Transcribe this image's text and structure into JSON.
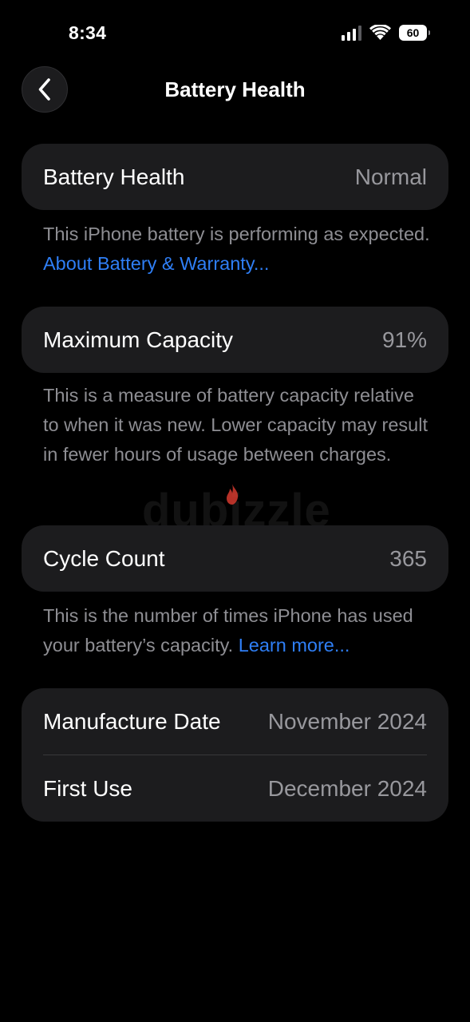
{
  "status_bar": {
    "time": "8:34",
    "battery_level": "60",
    "signal_bars_active": 3,
    "signal_bars_total": 4
  },
  "nav": {
    "title": "Battery Health",
    "back_icon": "chevron-left-icon"
  },
  "battery_health": {
    "label": "Battery Health",
    "value": "Normal",
    "note": "This iPhone battery is performing as expected.",
    "link": "About Battery & Warranty..."
  },
  "maximum_capacity": {
    "label": "Maximum Capacity",
    "value": "91%",
    "note": "This is a measure of battery capacity relative to when it was new. Lower capacity may result in fewer hours of usage between charges."
  },
  "cycle_count": {
    "label": "Cycle Count",
    "value": "365",
    "note": "This is the number of times iPhone has used your battery’s capacity.",
    "link": "Learn more..."
  },
  "dates": {
    "manufacture_label": "Manufacture Date",
    "manufacture_value": "November 2024",
    "first_use_label": "First Use",
    "first_use_value": "December 2024"
  },
  "watermark": "dubizzle",
  "colors": {
    "background": "#000000",
    "card": "#1c1c1e",
    "secondary_text": "#8e8e93",
    "link": "#2f7ff6"
  }
}
